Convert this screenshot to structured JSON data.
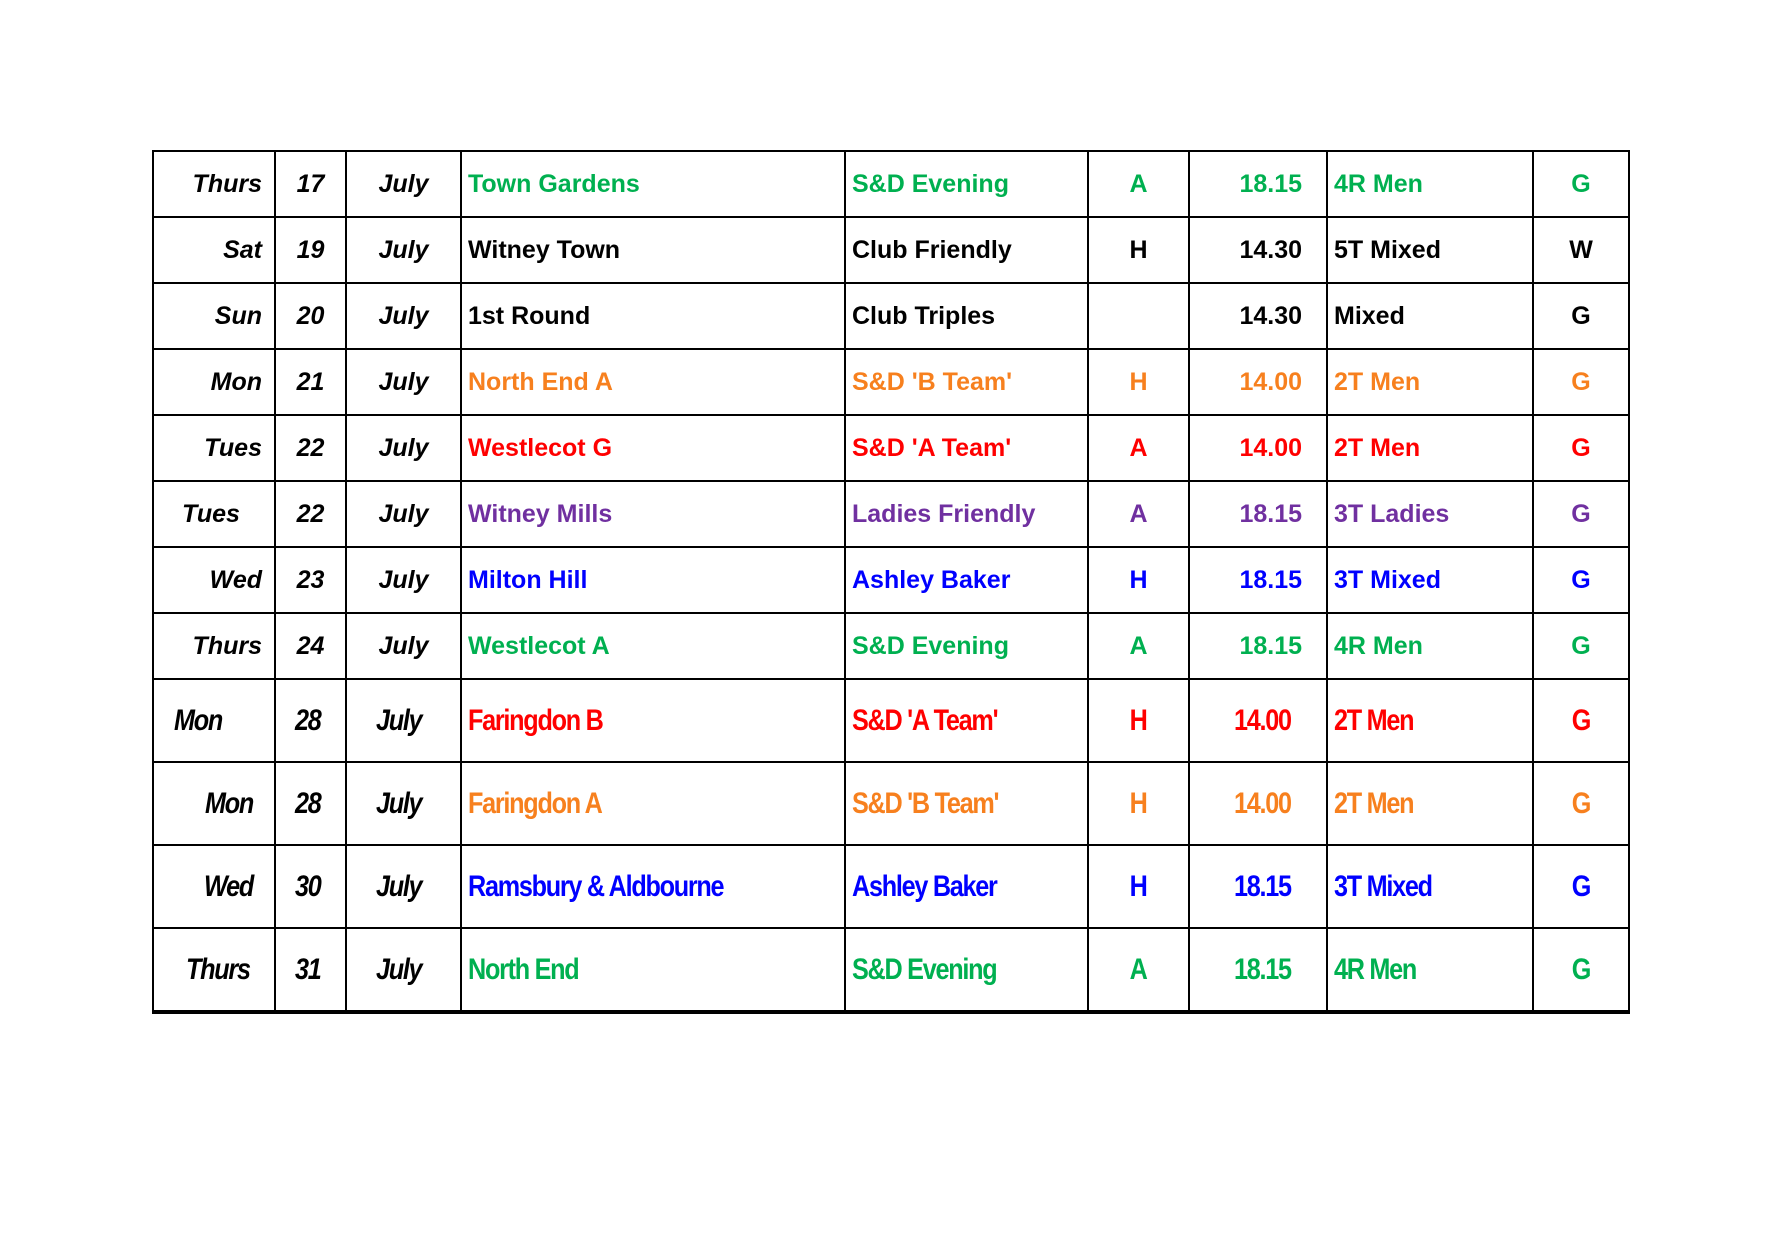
{
  "colors": {
    "black": "#000000",
    "green": "#00B050",
    "orange": "#F7801E",
    "red": "#FF0000",
    "purple": "#7030A0",
    "blue": "#0000FF"
  },
  "fixtures": [
    {
      "day": "Thurs",
      "date": "17",
      "month": "July",
      "opponent": "Town Gardens",
      "competition": "S&D Evening",
      "venue": "A",
      "time": "18.15",
      "format": "4R Men",
      "dress": "G",
      "color": "green"
    },
    {
      "day": "Sat",
      "date": "19",
      "month": "July",
      "opponent": "Witney Town",
      "competition": "Club Friendly",
      "venue": "H",
      "time": "14.30",
      "format": "5T Mixed",
      "dress": "W",
      "color": "black"
    },
    {
      "day": "Sun",
      "date": "20",
      "month": "July",
      "opponent": "1st Round",
      "competition": "Club Triples",
      "venue": "",
      "time": "14.30",
      "format": "Mixed",
      "dress": "G",
      "color": "black"
    },
    {
      "day": "Mon",
      "date": "21",
      "month": "July",
      "opponent": "North End A",
      "competition": "S&D 'B Team'",
      "venue": "H",
      "time": "14.00",
      "format": "2T Men",
      "dress": "G",
      "color": "orange"
    },
    {
      "day": "Tues",
      "date": "22",
      "month": "July",
      "opponent": "Westlecot G",
      "competition": "S&D 'A Team'",
      "venue": "A",
      "time": "14.00",
      "format": "2T Men",
      "dress": "G",
      "color": "red"
    },
    {
      "day": "Tues",
      "date": "22",
      "month": "July",
      "opponent": "Witney Mills",
      "competition": "Ladies Friendly",
      "venue": "A",
      "time": "18.15",
      "format": "3T Ladies",
      "dress": "G",
      "color": "purple"
    },
    {
      "day": "Wed",
      "date": "23",
      "month": "July",
      "opponent": "Milton Hill",
      "competition": "Ashley Baker",
      "venue": "H",
      "time": "18.15",
      "format": "3T Mixed",
      "dress": "G",
      "color": "blue"
    },
    {
      "day": "Thurs",
      "date": "24",
      "month": "July",
      "opponent": "Westlecot A",
      "competition": "S&D Evening",
      "venue": "A",
      "time": "18.15",
      "format": "4R Men",
      "dress": "G",
      "color": "green"
    },
    {
      "day": "Mon",
      "date": "28",
      "month": "July",
      "opponent": "Faringdon B",
      "competition": "S&D 'A Team'",
      "venue": "H",
      "time": "14.00",
      "format": "2T Men",
      "dress": "G",
      "color": "red"
    },
    {
      "day": "Mon",
      "date": "28",
      "month": "July",
      "opponent": "Faringdon A",
      "competition": "S&D 'B Team'",
      "venue": "H",
      "time": "14.00",
      "format": "2T Men",
      "dress": "G",
      "color": "orange"
    },
    {
      "day": "Wed",
      "date": "30",
      "month": "July",
      "opponent": "Ramsbury & Aldbourne",
      "competition": "Ashley Baker",
      "venue": "H",
      "time": "18.15",
      "format": "3T Mixed",
      "dress": "G",
      "color": "blue"
    },
    {
      "day": "Thurs",
      "date": "31",
      "month": "July",
      "opponent": "North End",
      "competition": "S&D Evening",
      "venue": "A",
      "time": "18.15",
      "format": "4R Men",
      "dress": "G",
      "color": "green"
    }
  ]
}
